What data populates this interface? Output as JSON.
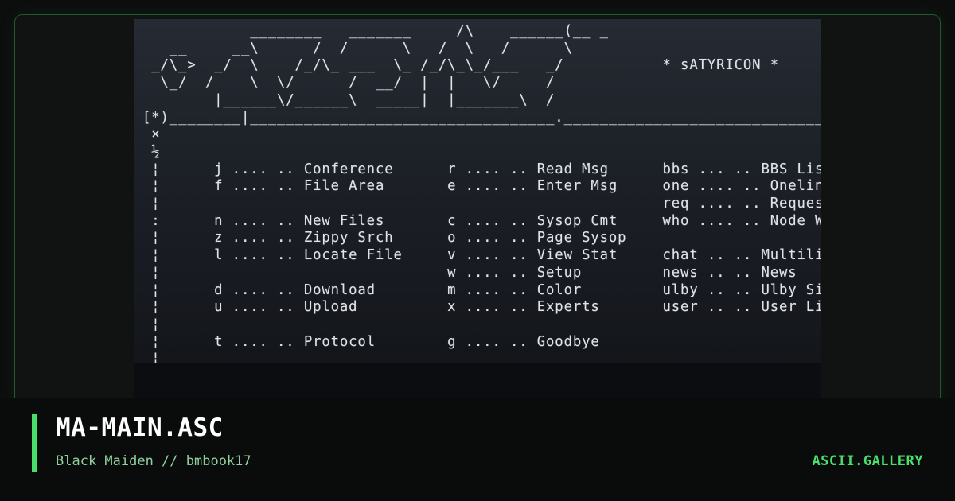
{
  "artwork": {
    "lines": [
      "            ________   _______     /\\    ______(__ _",
      "   __     __\\      /  /      \\   /  \\   /      \\",
      " _/\\_>  _/  \\    /_/\\_ ___  \\_ /_/\\_\\_/___   _/           * sATYRICON *",
      "  \\_/  /    \\  \\/      /  __/  |  |   \\/     /",
      "        |______\\/______\\  _____|  |_______\\  /",
      "[*)________|__________________________________.______________________________[*]",
      " ×                                                                           ×",
      " ½                                                                           ½",
      " ¦      j .... .. Conference      r .... .. Read Msg      bbs ... .. BBS Lister   ¦",
      " ¦      f .... .. File Area       e .... .. Enter Msg     one .... .. Oneliner",
      " ¦                                                        req .... .. Requests    .",
      " :      n .... .. New Files       c .... .. Sysop Cmt     who .... .. Node Watch  ¦",
      " ¦      z .... .. Zippy Srch      o .... .. Page Sysop",
      " ¦      l .... .. Locate File     v .... .. View Stat     chat .. .. Multiline    ¦",
      " ¦                                w .... .. Setup         news .. .. News         .",
      " ¦      d .... .. Download        m .... .. Color         ulby .. .. Ulby Signer  ¦",
      " ¦      u .... .. Upload          x .... .. Experts       user .. .. User List    ¦_",
      " ¦                                                                               _/",
      " ¦      t .... .. Protocol        g .... .. Goodbye                               ¦",
      " ¦                                                                                "
    ]
  },
  "caption": {
    "title": "MA-MAIN.ASC",
    "subtitle": "Black Maiden // bmbook17",
    "brand": "ASCII.GALLERY"
  },
  "colors": {
    "accent": "#4ade6b",
    "frame_border": "#1f5a2c",
    "background": "#0c0e0d"
  }
}
